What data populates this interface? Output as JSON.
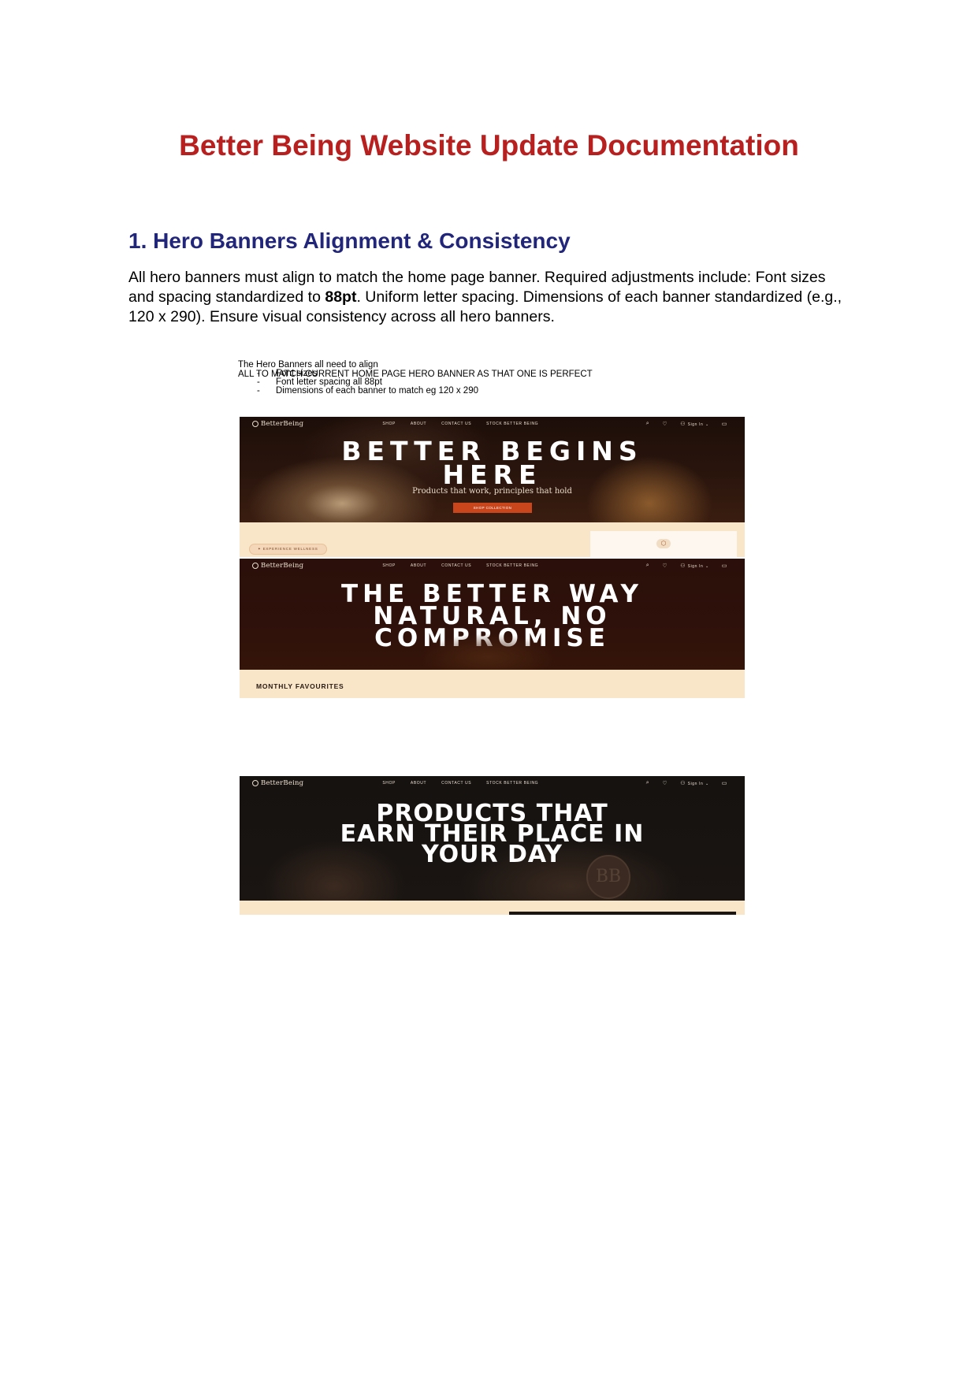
{
  "document": {
    "title": "Better Being Website Update Documentation",
    "section_heading": "1. Hero Banners Alignment & Consistency",
    "body_part1": "All hero banners must align to match the home page banner. Required adjustments include: Font sizes and spacing standardized to ",
    "body_bold": "88pt",
    "body_part2": ". Uniform letter spacing. Dimensions of each banner standardized (e.g., 120 x 290). Ensure visual consistency across all hero banners."
  },
  "notes": {
    "intro": "The Hero Banners all need to align",
    "items": [
      "Font sizes",
      "Font letter spacing all 88pt",
      "Dimensions of each banner to match eg 120 x 290"
    ],
    "alert": "ALL TO MATCH CURRENT HOME PAGE HERO BANNER AS THAT ONE IS PERFECT"
  },
  "site_nav": {
    "logo": "BetterBeing",
    "links_home": [
      "SHOP",
      "ABOUT",
      "CONTACT US",
      "STOCK BETTER BEING"
    ],
    "sign_in": "Sign In"
  },
  "banners": [
    {
      "headline_line1": "BETTER BEGINS",
      "headline_line2": "HERE",
      "tagline": "Products that work, principles that hold",
      "cta": "SHOP COLLECTION",
      "pill": "✦ EXPERIENCE WELLNESS"
    },
    {
      "headline_line1": "THE BETTER WAY",
      "headline_line2": "NATURAL, NO",
      "headline_line3": "COMPROMISE",
      "strip_label": "MONTHLY FAVOURITES"
    },
    {
      "headline_line1": "PRODUCTS THAT",
      "headline_line2": "EARN THEIR PLACE IN",
      "headline_line3": "YOUR DAY",
      "seal": "BB"
    }
  ],
  "colors": {
    "title_red": "#b8201f",
    "heading_navy": "#22267a",
    "alert_red": "#e1161b",
    "cta_orange": "#c9461c",
    "cream_strip": "#f9e5c7"
  }
}
